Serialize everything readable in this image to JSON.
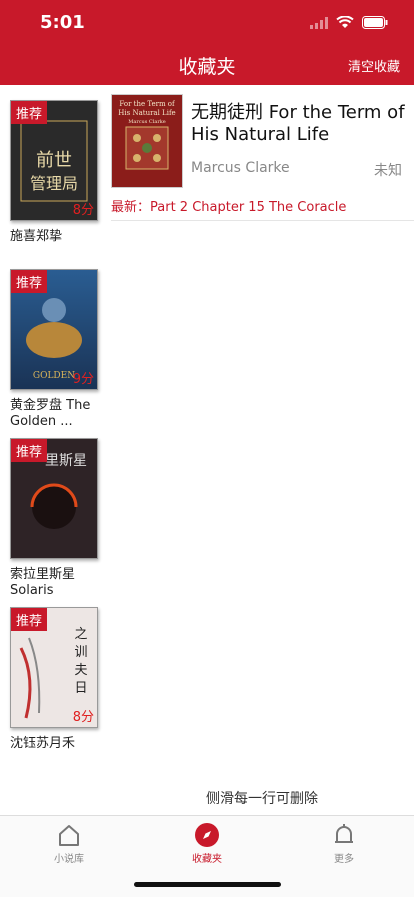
{
  "status_bar": {
    "time": "5:01"
  },
  "nav": {
    "title": "收藏夹",
    "right_button": "清空收藏"
  },
  "sidebar_books": [
    {
      "badge": "推荐",
      "score": "8分",
      "title": "施喜郑挚",
      "cover_color": "#2a2a2a"
    },
    {
      "badge": "推荐",
      "score": "9分",
      "title": "黄金罗盘 The Golden ...",
      "cover_color": "#1f4a7a"
    },
    {
      "badge": "推荐",
      "score": "",
      "title": "索拉里斯星 Solaris",
      "cover_color": "#3a2a30"
    },
    {
      "badge": "推荐",
      "score": "8分",
      "title": "沈钰苏月禾",
      "cover_color": "#e8e0de"
    }
  ],
  "favorite": {
    "title": "无期徒刑 For the Term of His Natural Life",
    "author": "Marcus Clarke",
    "status": "未知",
    "latest": "最新：Part 2 Chapter 15 The Coracle",
    "cover_text": "For the Term of His Natural Life",
    "cover_author": "Marcus Clarke"
  },
  "hint": "侧滑每一行可删除",
  "tabs": [
    {
      "label": "小说库",
      "icon": "home-icon"
    },
    {
      "label": "收藏夹",
      "icon": "compass-icon"
    },
    {
      "label": "更多",
      "icon": "bell-icon"
    }
  ],
  "colors": {
    "accent": "#c8192a"
  }
}
